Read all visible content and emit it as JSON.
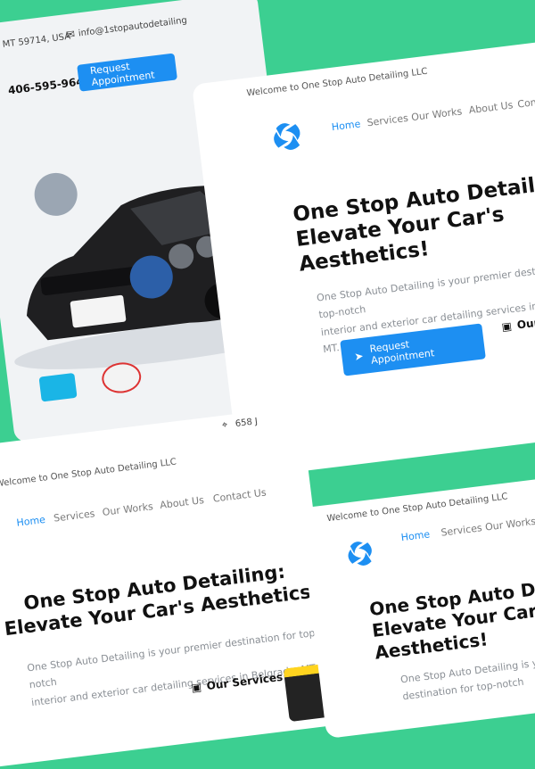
{
  "brand_color": "#1d8ff2",
  "background_color": "#3ccf91",
  "company": {
    "welcome": "Welcome to One Stop Auto Detailing LLC"
  },
  "nav": [
    "Home",
    "Services",
    "Our Works",
    "About Us",
    "Contac"
  ],
  "nav_full": [
    "Home",
    "Services",
    "Our Works",
    "About Us",
    "Contact Us"
  ],
  "hero": {
    "title_line1": "One Stop Auto Detailing:",
    "title_line2": "Elevate Your Car's Aesthetics!",
    "desc_line1": "One Stop Auto Detailing is your premier destination for top-notch",
    "desc_line2": "interior and exterior car detailing services in Belgrade, MT.",
    "cta": "Request Appointment",
    "services": "Our Services"
  },
  "topbar": {
    "address": "MT 59714, USA",
    "email": "info@1stopautodetailing",
    "phone": "406-595-9648",
    "cta": "Request Appointment",
    "address_short": "658 J"
  },
  "icons": [
    "mail-icon",
    "phone-icon",
    "location-icon",
    "send-icon",
    "briefcase-icon",
    "logo-icon"
  ]
}
